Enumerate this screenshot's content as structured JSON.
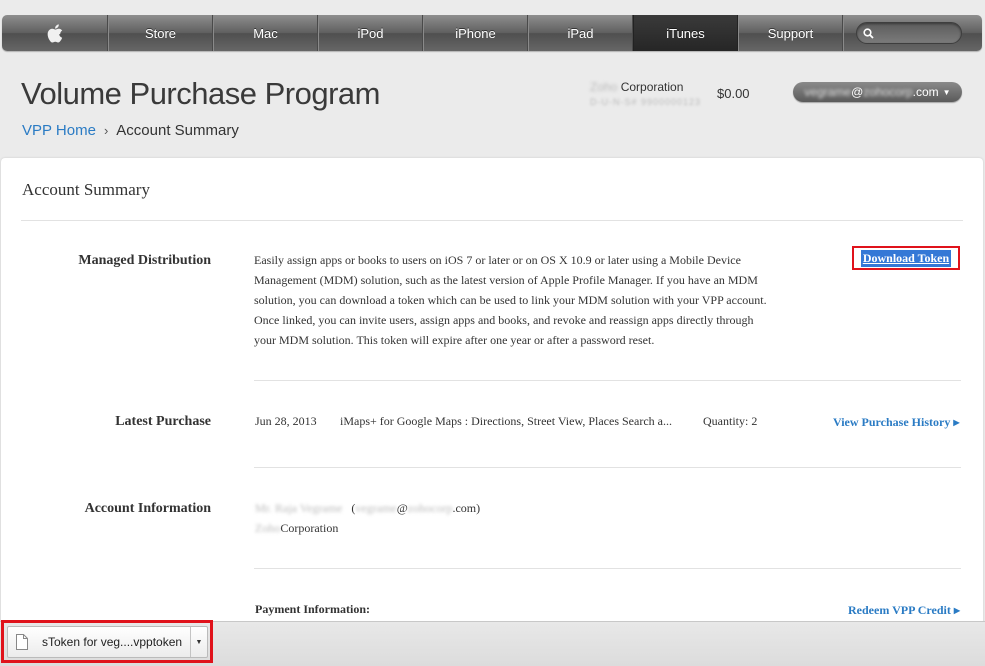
{
  "nav": {
    "apple_icon": "apple-logo-icon",
    "items": [
      {
        "label": "Store"
      },
      {
        "label": "Mac"
      },
      {
        "label": "iPod"
      },
      {
        "label": "iPhone"
      },
      {
        "label": "iPad"
      },
      {
        "label": "iTunes",
        "active": true
      },
      {
        "label": "Support"
      }
    ],
    "search_placeholder": ""
  },
  "header": {
    "title": "Volume Purchase Program",
    "breadcrumb": {
      "home": "VPP Home",
      "current": "Account Summary"
    },
    "org": {
      "name_redacted": "Zoho",
      "name": "Corporation",
      "id_redacted": "D-U-N-S# 9900000123"
    },
    "balance": "$0.00",
    "account": {
      "user_redacted": "vegrame",
      "domain_redacted": "zohocorp",
      "at": "@",
      "suffix": ".com"
    }
  },
  "card": {
    "title": "Account Summary",
    "managed": {
      "label": "Managed Distribution",
      "lines": [
        "Easily assign apps or books to users on iOS 7 or later or on OS X 10.9 or later using a Mobile Device",
        "Management (MDM) solution, such as the latest version of Apple Profile Manager. If you have an MDM",
        "solution, you can download a token which can be used to link your MDM solution with your VPP account.",
        "Once linked, you can invite users, assign apps and books, and revoke and reassign apps directly through",
        "your MDM solution. This token will expire after one year or after a password reset."
      ],
      "button": "Download Token"
    },
    "latest": {
      "label": "Latest Purchase",
      "date": "Jun 28, 2013",
      "item": "iMaps+ for Google Maps : Directions, Street View, Places Search a...",
      "quantity": "Quantity: 2",
      "link": "View Purchase History"
    },
    "account": {
      "label": "Account Information",
      "name_redacted": "Mr. Raja Vegrame",
      "email_user_redacted": "vegrame",
      "email_domain_redacted": "zohocorp",
      "open_paren": "(",
      "at": "@",
      "close": ".com)",
      "org_redacted": "Zoho",
      "org": "Corporation"
    },
    "payment": {
      "label": "Payment Information:",
      "link": "Redeem VPP Credit"
    }
  },
  "download_bar": {
    "filename": "sToken for veg....vpptoken"
  }
}
